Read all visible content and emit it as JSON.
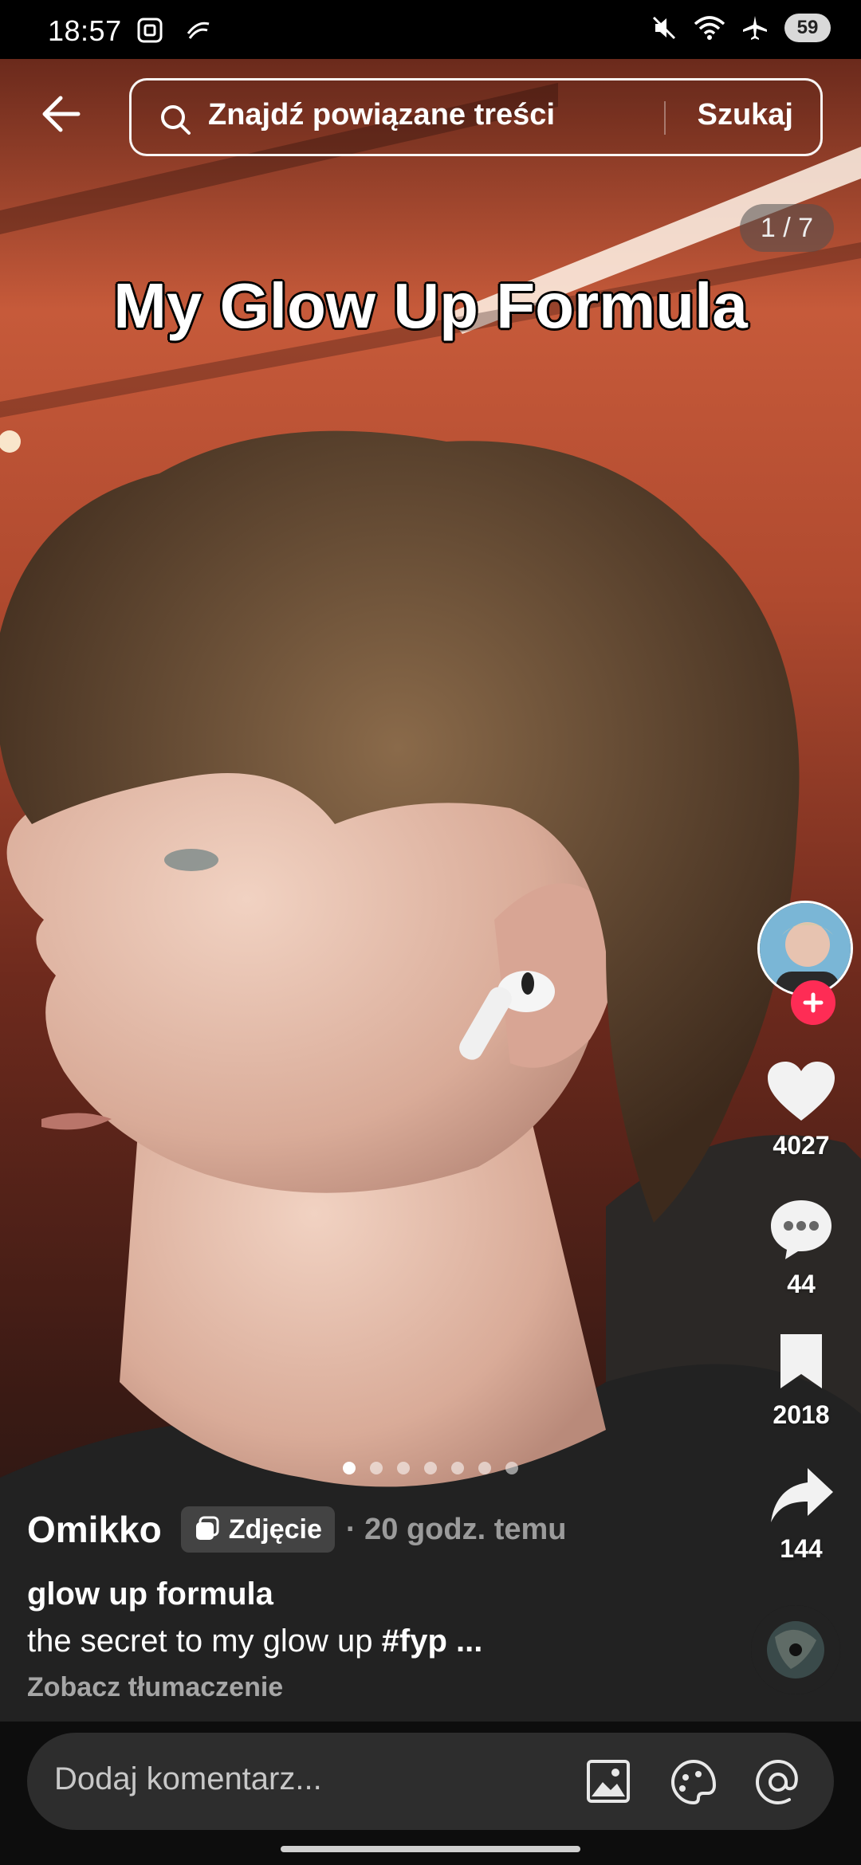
{
  "status_bar": {
    "time": "18:57",
    "battery": "59"
  },
  "search": {
    "placeholder": "Znajdź powiązane treści",
    "button": "Szukaj"
  },
  "counter": "1 / 7",
  "overlay_title": "My Glow Up Formula",
  "rail": {
    "likes": "4027",
    "comments": "44",
    "saves": "2018",
    "shares": "144"
  },
  "post": {
    "author": "Omikko",
    "type_label": "Zdjęcie",
    "time": "· 20 godz. temu",
    "title": "glow up formula",
    "description": "the secret to my glow up",
    "hashtag": "#fyp",
    "ellipsis": " ...",
    "translate": "Zobacz tłumaczenie"
  },
  "slides": {
    "total": 7,
    "active": 1
  },
  "comment": {
    "placeholder": "Dodaj komentarz..."
  },
  "colors": {
    "accent": "#fe2c55",
    "bg_warm": "#b5452b"
  }
}
